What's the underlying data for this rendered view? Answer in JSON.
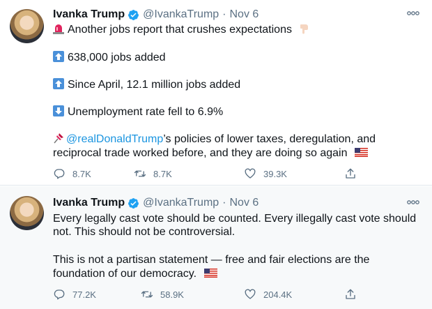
{
  "tweets": [
    {
      "author": {
        "name": "Ivanka Trump",
        "handle": "@IvankaTrump",
        "separator": "·",
        "time": "Nov 6"
      },
      "lines": [
        {
          "emoji": "alarm-light",
          "text": "Another jobs report that crushes expectations",
          "emoji_after": "pointing-down-hand"
        },
        {
          "emoji": "up-arrow",
          "text": "638,000 jobs added"
        },
        {
          "emoji": "up-arrow",
          "text": "Since April, 12.1 million jobs added"
        },
        {
          "emoji": "down-arrow",
          "text": "Unemployment rate fell to 6.9%"
        },
        {
          "emoji": "pushpin",
          "mention": "@realDonaldTrump",
          "text": "’s policies of lower taxes, deregulation, and"
        },
        {
          "text": "reciprocal trade worked before, and they are doing so again",
          "emoji_after": "us-flag"
        }
      ],
      "stats": {
        "replies": "8.7K",
        "retweets": "8.7K",
        "likes": "39.3K"
      }
    },
    {
      "author": {
        "name": "Ivanka Trump",
        "handle": "@IvankaTrump",
        "separator": "·",
        "time": "Nov 6"
      },
      "lines": [
        {
          "text": "Every legally cast vote should be counted. Every illegally cast vote should"
        },
        {
          "text": "not. This should not be controversial."
        },
        {
          "text": "This is not a partisan statement — free and fair elections are the"
        },
        {
          "text": "foundation of our democracy.",
          "emoji_after": "us-flag"
        }
      ],
      "stats": {
        "replies": "77.2K",
        "retweets": "58.9K",
        "likes": "204.4K"
      }
    }
  ],
  "colors": {
    "link": "#1b95e0",
    "verified": "#1da1f2",
    "muted": "#5b7083",
    "text": "#0f1419"
  }
}
